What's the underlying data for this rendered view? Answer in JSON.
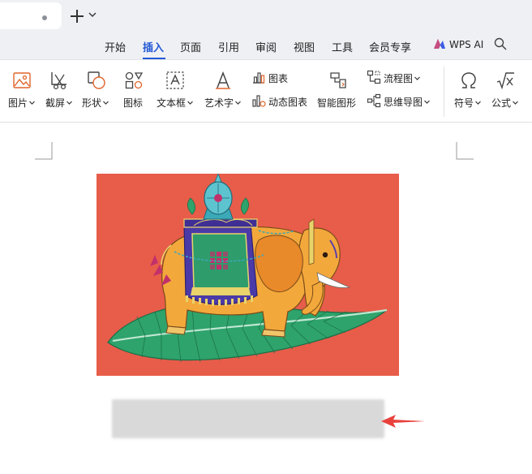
{
  "menu": {
    "items": [
      "开始",
      "插入",
      "页面",
      "引用",
      "审阅",
      "视图",
      "工具",
      "会员专享"
    ],
    "active": "插入",
    "wps_ai": "WPS AI"
  },
  "ribbon": {
    "picture": "图片",
    "screenshot": "截屏",
    "shape": "形状",
    "icon": "图标",
    "textbox": "文本框",
    "wordart": "艺术字",
    "chart": "图表",
    "dynamic_chart": "动态图表",
    "smart_graphic": "智能图形",
    "flowchart": "流程图",
    "mindmap": "思维导图",
    "symbol": "符号",
    "formula": "公式"
  },
  "colors": {
    "accent": "#2458d6",
    "image_background": "#e85c4a",
    "arrow": "#e8413c",
    "caption_placeholder": "#d9d9d9"
  }
}
